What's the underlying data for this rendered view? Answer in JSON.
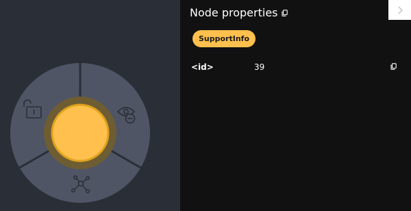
{
  "canvas": {
    "background_color": "#2a2e37",
    "radial_menu": {
      "segment_color": "#4f5564",
      "divider_color": "#2a2e37",
      "center_node": {
        "fill": "#ffc04d",
        "halo": "#6e5d32",
        "ring": "#e0a21e"
      },
      "items": [
        {
          "icon": "unlock-icon",
          "action": "Unlock node"
        },
        {
          "icon": "eye-hide-icon",
          "action": "Hide node"
        },
        {
          "icon": "expand-network-icon",
          "action": "Expand"
        }
      ]
    }
  },
  "panel": {
    "title": "Node properties",
    "close_icon": "chevron-right-icon",
    "label_badge": {
      "text": "SupportInfo",
      "color": "#ffc04d"
    },
    "properties": [
      {
        "key": "<id>",
        "value": "39"
      }
    ]
  }
}
